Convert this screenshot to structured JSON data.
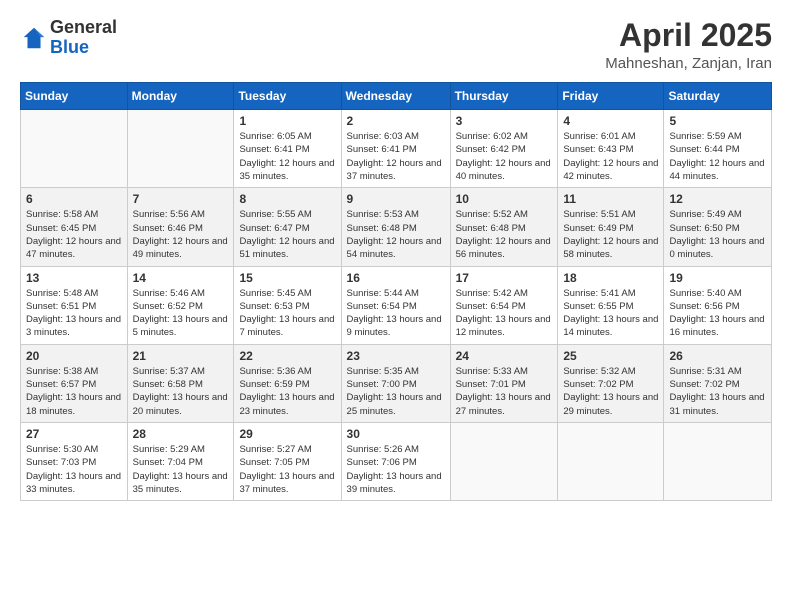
{
  "logo": {
    "general": "General",
    "blue": "Blue"
  },
  "header": {
    "month": "April 2025",
    "location": "Mahneshan, Zanjan, Iran"
  },
  "weekdays": [
    "Sunday",
    "Monday",
    "Tuesday",
    "Wednesday",
    "Thursday",
    "Friday",
    "Saturday"
  ],
  "weeks": [
    [
      {
        "day": "",
        "sunrise": "",
        "sunset": "",
        "daylight": ""
      },
      {
        "day": "",
        "sunrise": "",
        "sunset": "",
        "daylight": ""
      },
      {
        "day": "1",
        "sunrise": "Sunrise: 6:05 AM",
        "sunset": "Sunset: 6:41 PM",
        "daylight": "Daylight: 12 hours and 35 minutes."
      },
      {
        "day": "2",
        "sunrise": "Sunrise: 6:03 AM",
        "sunset": "Sunset: 6:41 PM",
        "daylight": "Daylight: 12 hours and 37 minutes."
      },
      {
        "day": "3",
        "sunrise": "Sunrise: 6:02 AM",
        "sunset": "Sunset: 6:42 PM",
        "daylight": "Daylight: 12 hours and 40 minutes."
      },
      {
        "day": "4",
        "sunrise": "Sunrise: 6:01 AM",
        "sunset": "Sunset: 6:43 PM",
        "daylight": "Daylight: 12 hours and 42 minutes."
      },
      {
        "day": "5",
        "sunrise": "Sunrise: 5:59 AM",
        "sunset": "Sunset: 6:44 PM",
        "daylight": "Daylight: 12 hours and 44 minutes."
      }
    ],
    [
      {
        "day": "6",
        "sunrise": "Sunrise: 5:58 AM",
        "sunset": "Sunset: 6:45 PM",
        "daylight": "Daylight: 12 hours and 47 minutes."
      },
      {
        "day": "7",
        "sunrise": "Sunrise: 5:56 AM",
        "sunset": "Sunset: 6:46 PM",
        "daylight": "Daylight: 12 hours and 49 minutes."
      },
      {
        "day": "8",
        "sunrise": "Sunrise: 5:55 AM",
        "sunset": "Sunset: 6:47 PM",
        "daylight": "Daylight: 12 hours and 51 minutes."
      },
      {
        "day": "9",
        "sunrise": "Sunrise: 5:53 AM",
        "sunset": "Sunset: 6:48 PM",
        "daylight": "Daylight: 12 hours and 54 minutes."
      },
      {
        "day": "10",
        "sunrise": "Sunrise: 5:52 AM",
        "sunset": "Sunset: 6:48 PM",
        "daylight": "Daylight: 12 hours and 56 minutes."
      },
      {
        "day": "11",
        "sunrise": "Sunrise: 5:51 AM",
        "sunset": "Sunset: 6:49 PM",
        "daylight": "Daylight: 12 hours and 58 minutes."
      },
      {
        "day": "12",
        "sunrise": "Sunrise: 5:49 AM",
        "sunset": "Sunset: 6:50 PM",
        "daylight": "Daylight: 13 hours and 0 minutes."
      }
    ],
    [
      {
        "day": "13",
        "sunrise": "Sunrise: 5:48 AM",
        "sunset": "Sunset: 6:51 PM",
        "daylight": "Daylight: 13 hours and 3 minutes."
      },
      {
        "day": "14",
        "sunrise": "Sunrise: 5:46 AM",
        "sunset": "Sunset: 6:52 PM",
        "daylight": "Daylight: 13 hours and 5 minutes."
      },
      {
        "day": "15",
        "sunrise": "Sunrise: 5:45 AM",
        "sunset": "Sunset: 6:53 PM",
        "daylight": "Daylight: 13 hours and 7 minutes."
      },
      {
        "day": "16",
        "sunrise": "Sunrise: 5:44 AM",
        "sunset": "Sunset: 6:54 PM",
        "daylight": "Daylight: 13 hours and 9 minutes."
      },
      {
        "day": "17",
        "sunrise": "Sunrise: 5:42 AM",
        "sunset": "Sunset: 6:54 PM",
        "daylight": "Daylight: 13 hours and 12 minutes."
      },
      {
        "day": "18",
        "sunrise": "Sunrise: 5:41 AM",
        "sunset": "Sunset: 6:55 PM",
        "daylight": "Daylight: 13 hours and 14 minutes."
      },
      {
        "day": "19",
        "sunrise": "Sunrise: 5:40 AM",
        "sunset": "Sunset: 6:56 PM",
        "daylight": "Daylight: 13 hours and 16 minutes."
      }
    ],
    [
      {
        "day": "20",
        "sunrise": "Sunrise: 5:38 AM",
        "sunset": "Sunset: 6:57 PM",
        "daylight": "Daylight: 13 hours and 18 minutes."
      },
      {
        "day": "21",
        "sunrise": "Sunrise: 5:37 AM",
        "sunset": "Sunset: 6:58 PM",
        "daylight": "Daylight: 13 hours and 20 minutes."
      },
      {
        "day": "22",
        "sunrise": "Sunrise: 5:36 AM",
        "sunset": "Sunset: 6:59 PM",
        "daylight": "Daylight: 13 hours and 23 minutes."
      },
      {
        "day": "23",
        "sunrise": "Sunrise: 5:35 AM",
        "sunset": "Sunset: 7:00 PM",
        "daylight": "Daylight: 13 hours and 25 minutes."
      },
      {
        "day": "24",
        "sunrise": "Sunrise: 5:33 AM",
        "sunset": "Sunset: 7:01 PM",
        "daylight": "Daylight: 13 hours and 27 minutes."
      },
      {
        "day": "25",
        "sunrise": "Sunrise: 5:32 AM",
        "sunset": "Sunset: 7:02 PM",
        "daylight": "Daylight: 13 hours and 29 minutes."
      },
      {
        "day": "26",
        "sunrise": "Sunrise: 5:31 AM",
        "sunset": "Sunset: 7:02 PM",
        "daylight": "Daylight: 13 hours and 31 minutes."
      }
    ],
    [
      {
        "day": "27",
        "sunrise": "Sunrise: 5:30 AM",
        "sunset": "Sunset: 7:03 PM",
        "daylight": "Daylight: 13 hours and 33 minutes."
      },
      {
        "day": "28",
        "sunrise": "Sunrise: 5:29 AM",
        "sunset": "Sunset: 7:04 PM",
        "daylight": "Daylight: 13 hours and 35 minutes."
      },
      {
        "day": "29",
        "sunrise": "Sunrise: 5:27 AM",
        "sunset": "Sunset: 7:05 PM",
        "daylight": "Daylight: 13 hours and 37 minutes."
      },
      {
        "day": "30",
        "sunrise": "Sunrise: 5:26 AM",
        "sunset": "Sunset: 7:06 PM",
        "daylight": "Daylight: 13 hours and 39 minutes."
      },
      {
        "day": "",
        "sunrise": "",
        "sunset": "",
        "daylight": ""
      },
      {
        "day": "",
        "sunrise": "",
        "sunset": "",
        "daylight": ""
      },
      {
        "day": "",
        "sunrise": "",
        "sunset": "",
        "daylight": ""
      }
    ]
  ]
}
